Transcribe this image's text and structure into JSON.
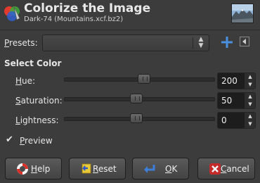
{
  "header": {
    "title": "Colorize the Image",
    "subtitle": "Dark-74 (Mountains.xcf.bz2)"
  },
  "presets": {
    "label": "Presets:",
    "value": ""
  },
  "section": {
    "title": "Select Color"
  },
  "sliders": [
    {
      "label": "Hue:",
      "value": "200",
      "fraction": 0.53
    },
    {
      "label": "Saturation:",
      "value": "50",
      "fraction": 0.48
    },
    {
      "label": "Lightness:",
      "value": "0",
      "fraction": 0.48
    }
  ],
  "preview": {
    "label": "Preview",
    "checked": true
  },
  "buttons": {
    "help": "Help",
    "reset": "Reset",
    "ok": "OK",
    "cancel": "Cancel"
  },
  "icons": {
    "app": "colorize-icon",
    "add": "plus-icon",
    "menu": "menu-triangle-icon",
    "help": "lifebuoy-icon",
    "reset": "reset-arrow-icon",
    "ok": "return-arrow-icon",
    "cancel": "cancel-x-icon"
  }
}
